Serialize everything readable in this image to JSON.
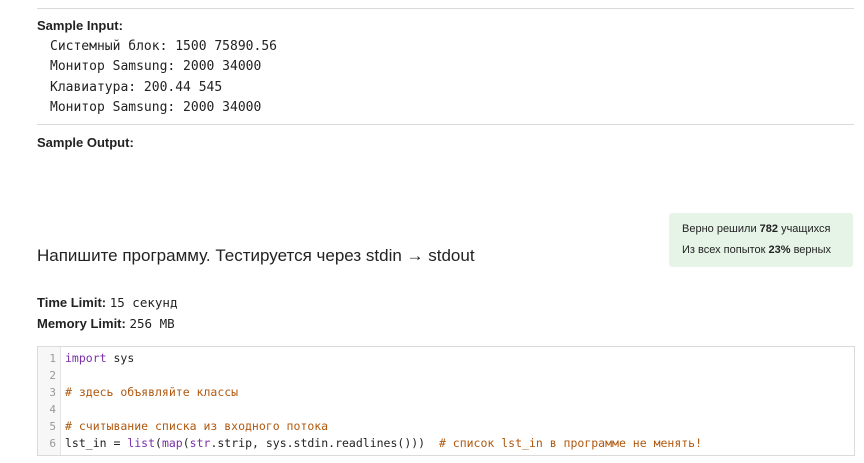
{
  "sample_input": {
    "label": "Sample Input:",
    "lines": [
      "Системный блок: 1500 75890.56",
      "Монитор Samsung: 2000 34000",
      "Клавиатура: 200.44 545",
      "Монитор Samsung: 2000 34000"
    ]
  },
  "sample_output": {
    "label": "Sample Output:"
  },
  "stats": {
    "line1_prefix": "Верно решили ",
    "line1_count": "782",
    "line1_suffix": " учащихся",
    "line2_prefix": "Из всех попыток ",
    "line2_percent": "23%",
    "line2_suffix": " верных"
  },
  "task": {
    "title": "Напишите программу. Тестируется через stdin → stdout",
    "time_limit_label": "Time Limit:",
    "time_limit_value": "15 секунд",
    "memory_limit_label": "Memory Limit:",
    "memory_limit_value": "256 MB"
  },
  "editor": {
    "line_numbers": [
      "1",
      "2",
      "3",
      "4",
      "5",
      "6"
    ],
    "line1_kw": "import",
    "line1_rest": " sys",
    "line3_comment": "# здесь объявляйте классы",
    "line5_comment": "# считывание списка из входного потока",
    "line6_a": "lst_in = ",
    "line6_list": "list",
    "line6_b": "(",
    "line6_map": "map",
    "line6_c": "(",
    "line6_str": "str",
    "line6_d": ".strip, sys.stdin.readlines()))  ",
    "line6_comment": "# список lst_in в программе не менять!"
  }
}
